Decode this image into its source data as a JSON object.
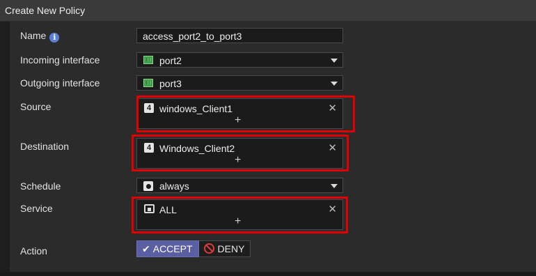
{
  "window": {
    "title": "Create New Policy"
  },
  "labels": {
    "name": "Name",
    "incoming": "Incoming interface",
    "outgoing": "Outgoing interface",
    "source": "Source",
    "destination": "Destination",
    "schedule": "Schedule",
    "service": "Service",
    "action": "Action"
  },
  "fields": {
    "name_value": "access_port2_to_port3",
    "incoming_value": "port2",
    "outgoing_value": "port3",
    "source_item": "windows_Client1",
    "destination_item": "Windows_Client2",
    "schedule_value": "always",
    "service_item": "ALL"
  },
  "glyphs": {
    "remove": "✕",
    "add": "+",
    "info": "i",
    "address": "4",
    "check": "✔"
  },
  "action": {
    "accept_label": "ACCEPT",
    "deny_label": "DENY",
    "selected": "ACCEPT"
  },
  "colors": {
    "accent": "#5a5fa3",
    "highlight": "#e00000",
    "deny": "#e23a3a",
    "port": "#3fa34d"
  },
  "icons": {
    "info": "info-circle-icon",
    "port": "ethernet-port-icon",
    "address": "address-object-icon",
    "schedule": "schedule-clock-icon",
    "service": "service-icon",
    "remove": "close-icon",
    "add": "plus-icon",
    "accept": "checkmark-icon",
    "deny": "deny-icon"
  }
}
